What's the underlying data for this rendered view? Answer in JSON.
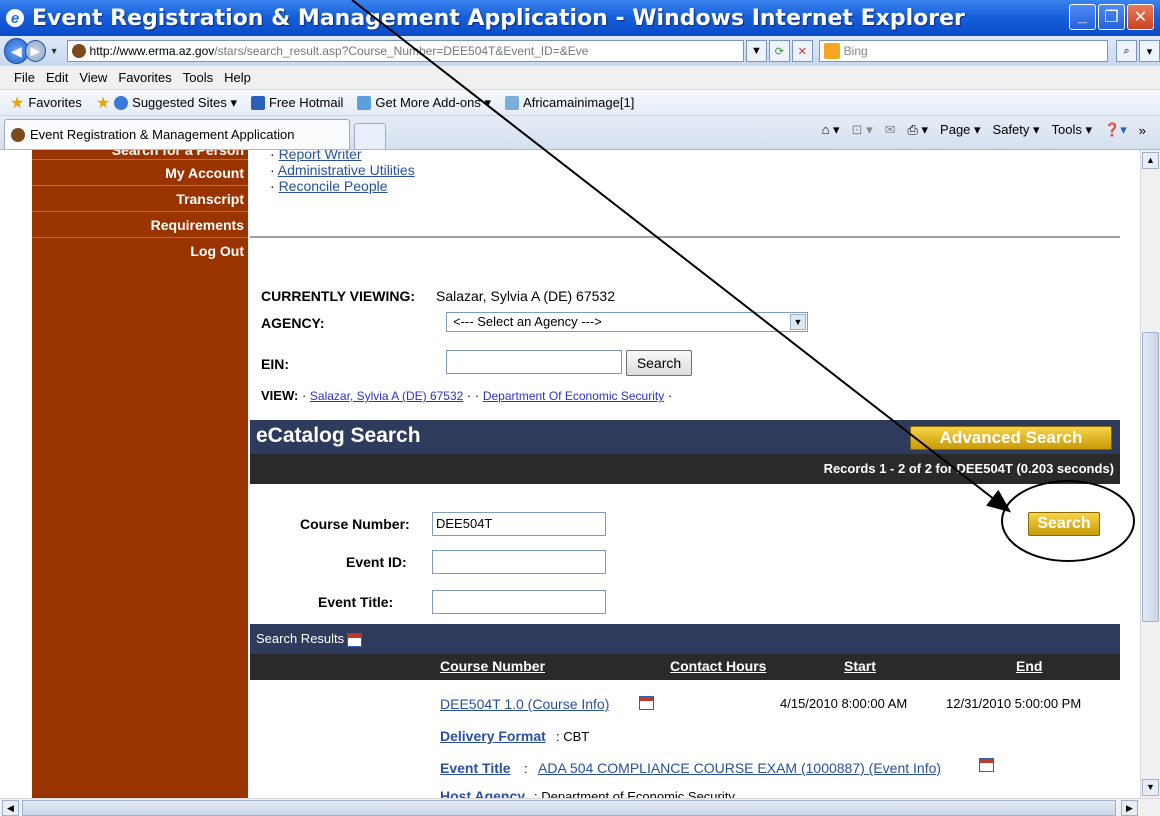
{
  "window": {
    "title": "Event Registration & Management Application - Windows Internet Explorer"
  },
  "address": {
    "url_host": "http://www.erma.az.gov",
    "url_path": "/stars/search_result.asp?Course_Number=DEE504T&Event_ID=&Eve",
    "search_placeholder": "Bing"
  },
  "menu": [
    "File",
    "Edit",
    "View",
    "Favorites",
    "Tools",
    "Help"
  ],
  "favorites": {
    "label": "Favorites",
    "items": [
      "Suggested Sites ▾",
      "Free Hotmail",
      "Get More Add-ons ▾",
      "Africamainimage[1]"
    ]
  },
  "tab": {
    "title": "Event Registration & Management Application"
  },
  "commands": [
    "Page ▾",
    "Safety ▾",
    "Tools ▾"
  ],
  "sidebar": {
    "items": [
      "Search for a Person",
      "My Account",
      "Transcript",
      "Requirements",
      "Log Out"
    ]
  },
  "admin_links": [
    "Report Writer",
    "Administrative Utilities",
    "Reconcile People"
  ],
  "viewing": {
    "label": "CURRENTLY VIEWING:",
    "value": "Salazar, Sylvia A (DE) 67532",
    "agency_label": "AGENCY:",
    "agency_selected": "<--- Select an Agency --->",
    "ein_label": "EIN:",
    "ein_value": "",
    "ein_search": "Search",
    "view_label": "VIEW:",
    "view_links": [
      "Salazar, Sylvia A (DE) 67532",
      "Department Of Economic Security"
    ]
  },
  "catalog": {
    "title": "eCatalog Search",
    "advanced": "Advanced Search",
    "records": "Records 1 - 2 of 2 for DEE504T (0.203 seconds)",
    "course_label": "Course Number:",
    "course_value": "DEE504T",
    "event_id_label": "Event ID:",
    "event_title_label": "Event Title:",
    "search_button": "Search"
  },
  "results": {
    "header": "Search Results",
    "columns": [
      "Course Number",
      "Contact Hours",
      "Start",
      "End"
    ],
    "row": {
      "course": "DEE504T 1.0 (Course Info)",
      "start": "4/15/2010 8:00:00 AM",
      "end": "12/31/2010 5:00:00 PM",
      "delivery_label": "Delivery Format",
      "delivery_value": ": CBT",
      "event_title_label": "Event Title",
      "event_title_value": "ADA 504 COMPLIANCE COURSE EXAM (1000887) (Event Info)",
      "host_label": "Host Agency",
      "host_value": ": Department of Economic Security"
    }
  }
}
